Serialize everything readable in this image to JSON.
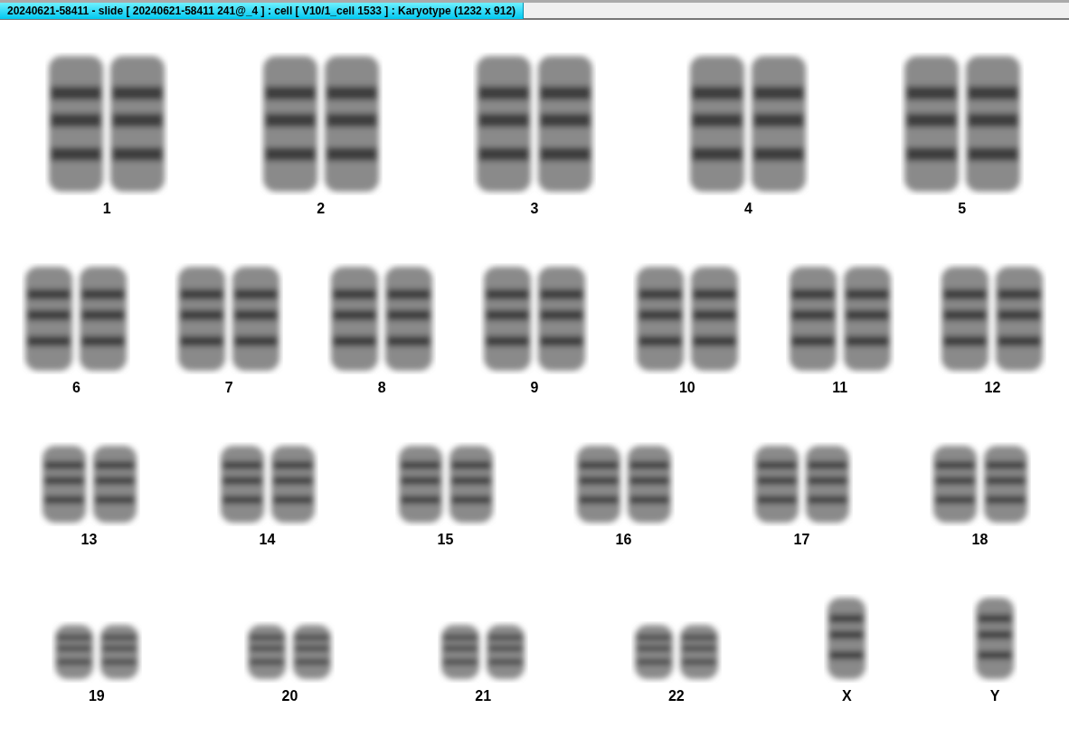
{
  "window": {
    "title": "20240621-58411 - slide [ 20240621-58411 241@_4 ] : cell [ V10/1_cell 1533 ] : Karyotype  (1232 x 912)"
  },
  "karyotype": {
    "rows": [
      {
        "chromosomes": [
          {
            "label": "1",
            "kind": "pair"
          },
          {
            "label": "2",
            "kind": "pair"
          },
          {
            "label": "3",
            "kind": "pair"
          },
          {
            "label": "4",
            "kind": "pair"
          },
          {
            "label": "5",
            "kind": "pair"
          }
        ]
      },
      {
        "chromosomes": [
          {
            "label": "6",
            "kind": "pair"
          },
          {
            "label": "7",
            "kind": "pair"
          },
          {
            "label": "8",
            "kind": "pair"
          },
          {
            "label": "9",
            "kind": "pair"
          },
          {
            "label": "10",
            "kind": "pair"
          },
          {
            "label": "11",
            "kind": "pair"
          },
          {
            "label": "12",
            "kind": "pair"
          }
        ]
      },
      {
        "chromosomes": [
          {
            "label": "13",
            "kind": "pair"
          },
          {
            "label": "14",
            "kind": "pair"
          },
          {
            "label": "15",
            "kind": "pair"
          },
          {
            "label": "16",
            "kind": "pair"
          },
          {
            "label": "17",
            "kind": "pair"
          },
          {
            "label": "18",
            "kind": "pair"
          }
        ]
      },
      {
        "chromosomes": [
          {
            "label": "19",
            "kind": "pair"
          },
          {
            "label": "20",
            "kind": "pair"
          },
          {
            "label": "21",
            "kind": "pair"
          },
          {
            "label": "22",
            "kind": "pair"
          },
          {
            "label": "X",
            "kind": "single"
          },
          {
            "label": "Y",
            "kind": "single"
          }
        ]
      }
    ]
  }
}
